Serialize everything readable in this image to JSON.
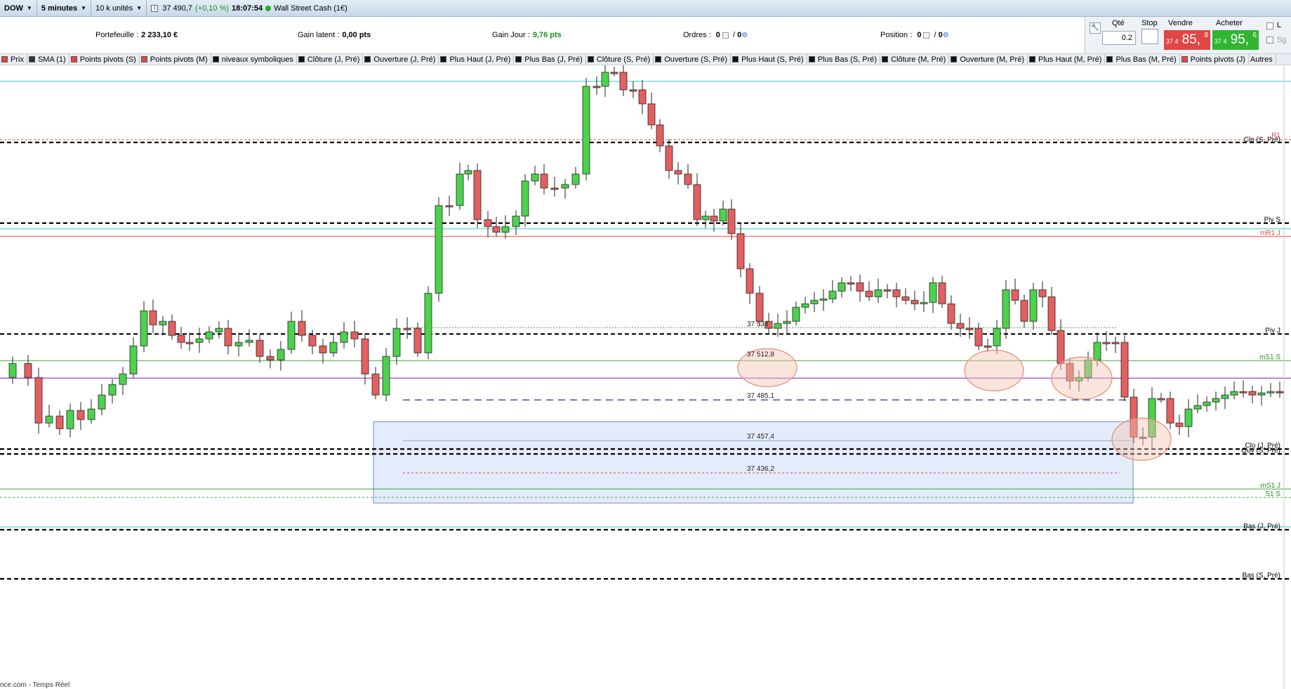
{
  "toolbar": {
    "instrument": "DOW",
    "timeframe": "5 minutes",
    "units": "10 k unités",
    "price": "37 490,7",
    "change": "(+0,10 %)",
    "time": "18:07:54",
    "product": "Wall Street Cash (1€)"
  },
  "portfolio": {
    "portefeuille_label": "Portefeuille :",
    "portefeuille_value": "2 233,10 €",
    "gain_latent_label": "Gain latent :",
    "gain_latent_value": "0,00 pts",
    "gain_jour_label": "Gain Jour :",
    "gain_jour_value": "9,76 pts",
    "ordres_label": "Ordres :",
    "ordres_a": "0",
    "ordres_b": "0",
    "position_label": "Position :",
    "position_a": "0",
    "position_b": "0"
  },
  "order_panel": {
    "qty_label": "Qté",
    "qty_value": "0.2",
    "stop_label": "Stop",
    "sell_label": "Vendre",
    "sell_prefix": "37 4",
    "sell_big": "85,",
    "sell_sup": "8",
    "buy_label": "Acheter",
    "buy_prefix": "37 4",
    "buy_big": "95,",
    "buy_sup": "6",
    "opt_l": "L",
    "opt_sg": "Sg"
  },
  "legend": [
    {
      "label": "Prix",
      "color": "#e04646"
    },
    {
      "label": "SMA (1)",
      "color": "#333333"
    },
    {
      "label": "Points pivots (S)",
      "color": "#e04646"
    },
    {
      "label": "Points pivots (M)",
      "color": "#e04646"
    },
    {
      "label": "niveaux symboliques",
      "color": "#111111"
    },
    {
      "label": "Clôture (J, Pré)",
      "color": "#111111"
    },
    {
      "label": "Ouverture (J, Pré)",
      "color": "#111111"
    },
    {
      "label": "Plus Haut (J, Pré)",
      "color": "#111111"
    },
    {
      "label": "Plus Bas (J, Pré)",
      "color": "#111111"
    },
    {
      "label": "Clôture (S, Pré)",
      "color": "#111111"
    },
    {
      "label": "Ouverture (S, Pré)",
      "color": "#111111"
    },
    {
      "label": "Plus Haut (S, Pré)",
      "color": "#111111"
    },
    {
      "label": "Plus Bas (S, Pré)",
      "color": "#111111"
    },
    {
      "label": "Clôture (M, Pré)",
      "color": "#111111"
    },
    {
      "label": "Ouverture (M, Pré)",
      "color": "#111111"
    },
    {
      "label": "Plus Haut (M, Pré)",
      "color": "#111111"
    },
    {
      "label": "Plus Bas (M, Pré)",
      "color": "#111111"
    },
    {
      "label": "Points pivots (J)",
      "color": "#e04646"
    },
    {
      "label": "Autres",
      "color": ""
    }
  ],
  "chart_labels": {
    "r1": "R1",
    "clo_s": "Clo (S, Pré)",
    "piv_s": "Piv S",
    "mr1_j": "mR1 J",
    "piv_j": "Piv J",
    "ms1_s": "mS1 S",
    "clo_j": "Clo (J, Pré)",
    "ouv_s": "Ouv (S, Pré)",
    "ms1_j": "mS1 J",
    "s1_s": "S1 S",
    "bas_j": "Bas (J, Pré)",
    "bas_s": "Bas (S, Pré)",
    "p1": "37 534",
    "p2": "37 512,8",
    "p3": "37 485,1",
    "p4": "37 457,4",
    "p5": "37 436,2"
  },
  "footer": "nce.com - Temps Réel"
}
